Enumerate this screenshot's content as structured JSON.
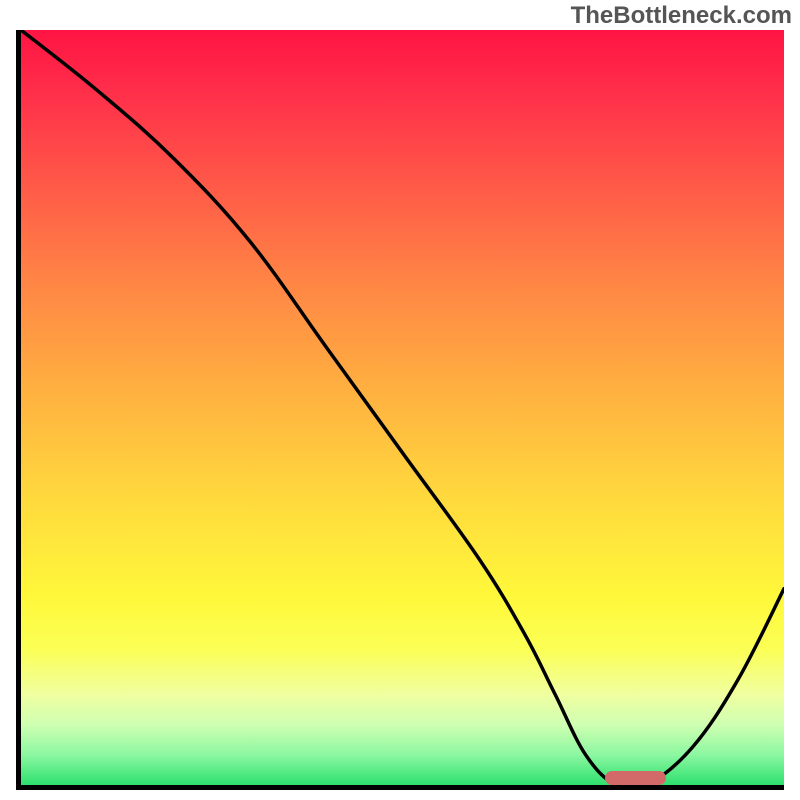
{
  "watermark": "TheBottleneck.com",
  "chart_data": {
    "type": "line",
    "title": "",
    "xlabel": "",
    "ylabel": "",
    "xlim": [
      0,
      100
    ],
    "ylim": [
      0,
      100
    ],
    "series": [
      {
        "name": "curve",
        "x": [
          0,
          10,
          20,
          30,
          40,
          50,
          60,
          66,
          70,
          74,
          78,
          82,
          88,
          94,
          100
        ],
        "y": [
          100,
          92,
          83,
          72,
          58,
          44,
          30,
          20,
          12,
          4,
          0,
          0,
          5,
          14,
          26
        ]
      }
    ],
    "marker": {
      "x_start": 76,
      "x_end": 84,
      "y": 0
    },
    "gradient_colors": {
      "top": "#ff1443",
      "mid": "#ffd93d",
      "bottom": "#2de06e"
    }
  }
}
